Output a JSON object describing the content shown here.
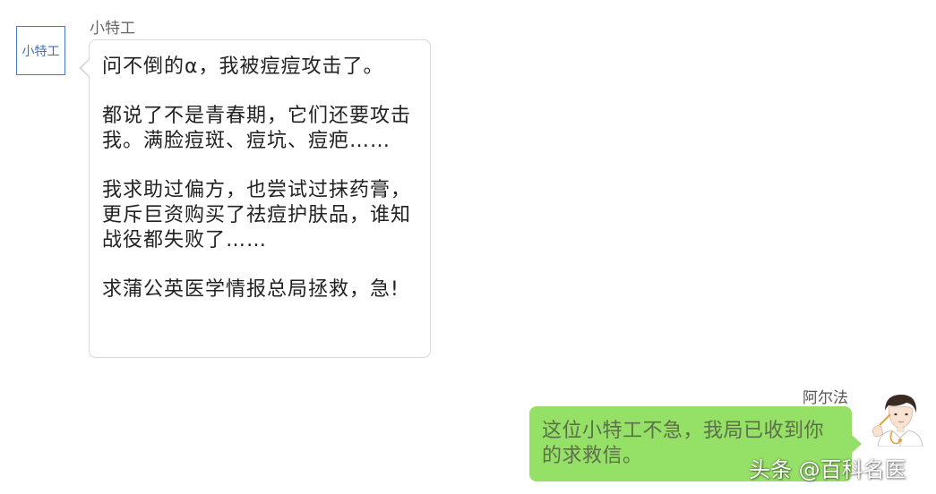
{
  "left_message": {
    "avatar_text": "小特工",
    "sender_name": "小特工",
    "paragraphs": [
      "问不倒的α，我被痘痘攻击了。",
      "都说了不是青春期，它们还要攻击我。满脸痘斑、痘坑、痘疤……",
      "我求助过偏方，也尝试过抹药膏，更斥巨资购买了祛痘护肤品，谁知战役都失败了……",
      "求蒲公英医学情报总局拯救，急!"
    ],
    "colors": {
      "avatar_border": "#4a78c8",
      "bubble_border": "#d8d8d8"
    }
  },
  "right_message": {
    "sender_name": "阿尔法",
    "text": "这位小特工不急，我局已收到你的求救信。",
    "avatar_icon": "cartoon-doctor-avatar",
    "colors": {
      "bubble_bg": "#95e066",
      "text": "#5c6f4a"
    }
  },
  "watermark": "头条 @百科名医"
}
